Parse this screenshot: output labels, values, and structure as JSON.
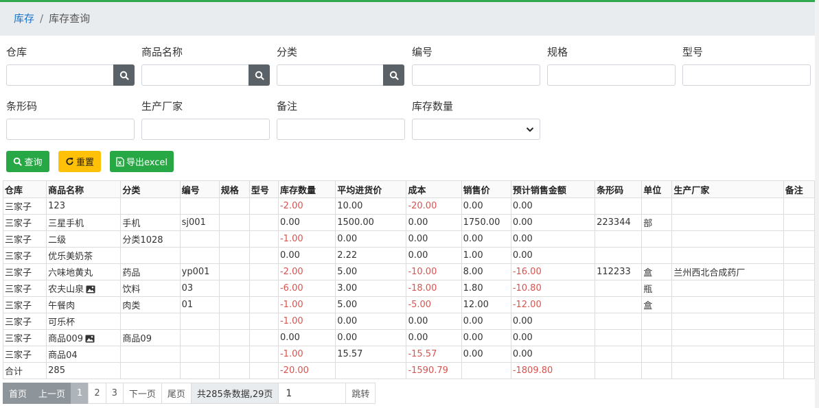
{
  "breadcrumb": {
    "parent": "库存",
    "separator": "/",
    "current": "库存查询"
  },
  "filters": {
    "warehouse_label": "仓库",
    "product_name_label": "商品名称",
    "category_label": "分类",
    "code_label": "编号",
    "spec_label": "规格",
    "model_label": "型号",
    "barcode_label": "条形码",
    "manufacturer_label": "生产厂家",
    "remark_label": "备注",
    "stock_qty_label": "库存数量"
  },
  "buttons": {
    "query": "查询",
    "reset": "重置",
    "export": "导出excel"
  },
  "table": {
    "headers": [
      "仓库",
      "商品名称",
      "分类",
      "编号",
      "规格",
      "型号",
      "库存数量",
      "平均进货价",
      "成本",
      "销售价",
      "预计销售金额",
      "条形码",
      "单位",
      "生产厂家",
      "备注"
    ],
    "rows": [
      {
        "warehouse": "三家子",
        "name": "123",
        "category": "",
        "code": "",
        "spec": "",
        "model": "",
        "qty": "-2.00",
        "avg_price": "10.00",
        "cost": "-20.00",
        "sale_price": "0.00",
        "est_sales": "0.00",
        "barcode": "",
        "unit": "",
        "manufacturer": "",
        "remark": "",
        "has_image": false
      },
      {
        "warehouse": "三家子",
        "name": "三星手机",
        "category": "手机",
        "code": "sj001",
        "spec": "",
        "model": "",
        "qty": "0.00",
        "avg_price": "1500.00",
        "cost": "0.00",
        "sale_price": "1750.00",
        "est_sales": "0.00",
        "barcode": "223344",
        "unit": "部",
        "manufacturer": "",
        "remark": "",
        "has_image": false
      },
      {
        "warehouse": "三家子",
        "name": "二级",
        "category": "分类1028",
        "code": "",
        "spec": "",
        "model": "",
        "qty": "-1.00",
        "avg_price": "0.00",
        "cost": "0.00",
        "sale_price": "0.00",
        "est_sales": "0.00",
        "barcode": "",
        "unit": "",
        "manufacturer": "",
        "remark": "",
        "has_image": false
      },
      {
        "warehouse": "三家子",
        "name": "优乐美奶茶",
        "category": "",
        "code": "",
        "spec": "",
        "model": "",
        "qty": "0.00",
        "avg_price": "2.22",
        "cost": "0.00",
        "sale_price": "1.00",
        "est_sales": "0.00",
        "barcode": "",
        "unit": "",
        "manufacturer": "",
        "remark": "",
        "has_image": false
      },
      {
        "warehouse": "三家子",
        "name": "六味地黄丸",
        "category": "药品",
        "code": "yp001",
        "spec": "",
        "model": "",
        "qty": "-2.00",
        "avg_price": "5.00",
        "cost": "-10.00",
        "sale_price": "8.00",
        "est_sales": "-16.00",
        "barcode": "112233",
        "unit": "盒",
        "manufacturer": "兰州西北合成药厂",
        "remark": "",
        "has_image": false
      },
      {
        "warehouse": "三家子",
        "name": "农夫山泉",
        "category": "饮料",
        "code": "03",
        "spec": "",
        "model": "",
        "qty": "-6.00",
        "avg_price": "3.00",
        "cost": "-18.00",
        "sale_price": "1.80",
        "est_sales": "-10.80",
        "barcode": "",
        "unit": "瓶",
        "manufacturer": "",
        "remark": "",
        "has_image": true
      },
      {
        "warehouse": "三家子",
        "name": "午餐肉",
        "category": "肉类",
        "code": "01",
        "spec": "",
        "model": "",
        "qty": "-1.00",
        "avg_price": "5.00",
        "cost": "-5.00",
        "sale_price": "12.00",
        "est_sales": "-12.00",
        "barcode": "",
        "unit": "盒",
        "manufacturer": "",
        "remark": "",
        "has_image": false
      },
      {
        "warehouse": "三家子",
        "name": "可乐杯",
        "category": "",
        "code": "",
        "spec": "",
        "model": "",
        "qty": "-1.00",
        "avg_price": "0.00",
        "cost": "0.00",
        "sale_price": "0.00",
        "est_sales": "0.00",
        "barcode": "",
        "unit": "",
        "manufacturer": "",
        "remark": "",
        "has_image": false
      },
      {
        "warehouse": "三家子",
        "name": "商品009",
        "category": "商品09",
        "code": "",
        "spec": "",
        "model": "",
        "qty": "0.00",
        "avg_price": "0.00",
        "cost": "0.00",
        "sale_price": "0.00",
        "est_sales": "0.00",
        "barcode": "",
        "unit": "",
        "manufacturer": "",
        "remark": "",
        "has_image": true
      },
      {
        "warehouse": "三家子",
        "name": "商品04",
        "category": "",
        "code": "",
        "spec": "",
        "model": "",
        "qty": "-1.00",
        "avg_price": "15.57",
        "cost": "-15.57",
        "sale_price": "0.00",
        "est_sales": "0.00",
        "barcode": "",
        "unit": "",
        "manufacturer": "",
        "remark": "",
        "has_image": false
      }
    ],
    "total": {
      "label": "合计",
      "count": "285",
      "qty": "-20.00",
      "cost": "-1590.79",
      "est_sales": "-1809.80"
    }
  },
  "pagination": {
    "first": "首页",
    "prev": "上一页",
    "pages": [
      "1",
      "2",
      "3"
    ],
    "next": "下一页",
    "last": "尾页",
    "info": "共285条数据,29页",
    "jump_value": "1",
    "jump_button": "跳转"
  },
  "colors": {
    "accent_green": "#28a745",
    "warning_yellow": "#ffc107",
    "negative_red": "#d9534f",
    "top_bar": "#2fa84f"
  },
  "icons": {
    "search": "search-icon",
    "reset": "refresh-icon",
    "export": "excel-file-icon",
    "image": "image-icon",
    "select": "chevron-down-icon"
  }
}
